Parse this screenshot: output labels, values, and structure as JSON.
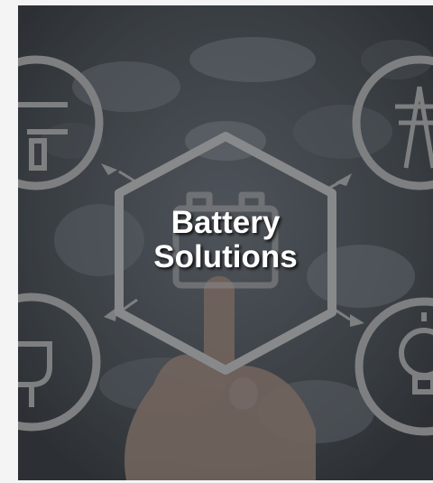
{
  "hero": {
    "title_line1": "Battery",
    "title_line2": "Solutions"
  },
  "colors": {
    "overlay": "#2b2f33",
    "icon_gray": "#9a9a9a",
    "text": "#ffffff"
  },
  "icons": [
    "battery-icon",
    "tools-icon",
    "power-tower-icon",
    "plug-icon",
    "lightbulb-icon"
  ]
}
